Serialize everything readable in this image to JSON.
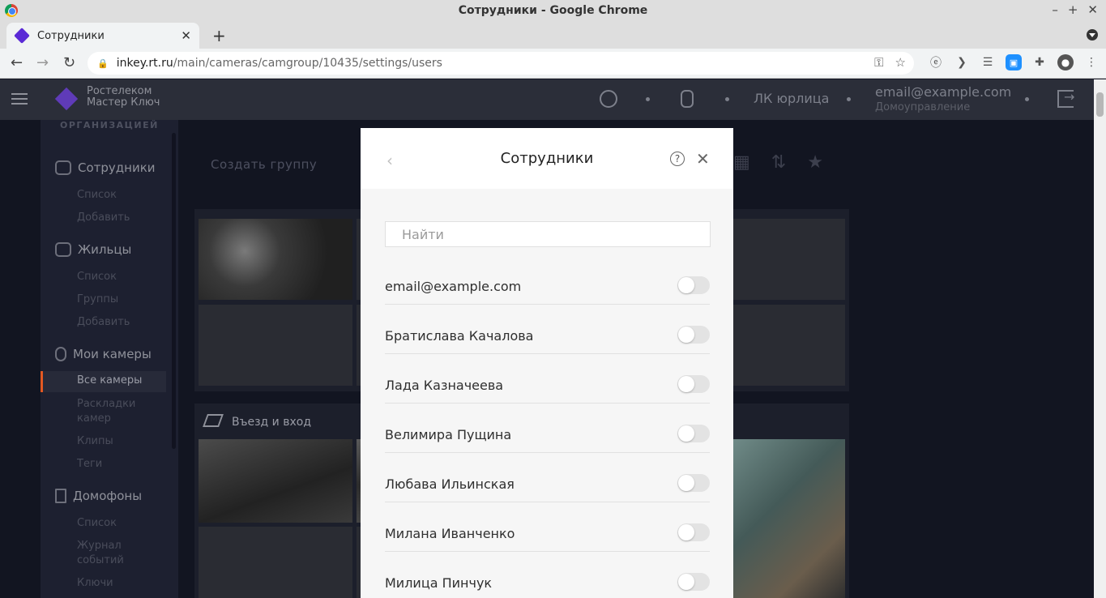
{
  "browser": {
    "window_title": "Сотрудники - Google Chrome",
    "tab_title": "Сотрудники",
    "url_host": "inkey.rt.ru",
    "url_path": "/main/cameras/camgroup/10435/settings/users"
  },
  "header": {
    "logo_line1": "Ростелеком",
    "logo_line2": "Мастер Ключ",
    "account_label": "ЛК юрлица",
    "user_email": "email@example.com",
    "user_role": "Домоуправление"
  },
  "sidebar": {
    "caption": "ОРГАНИЗАЦИЕЙ",
    "sections": [
      {
        "label": "Сотрудники",
        "items": [
          "Список",
          "Добавить"
        ]
      },
      {
        "label": "Жильцы",
        "items": [
          "Список",
          "Группы",
          "Добавить"
        ]
      },
      {
        "label": "Мои камеры",
        "items": [
          "Все камеры",
          "Раскладки камер",
          "Клипы",
          "Теги"
        ]
      },
      {
        "label": "Домофоны",
        "items": [
          "Список",
          "Журнал событий",
          "Ключи"
        ]
      }
    ],
    "active_item": "Все камеры"
  },
  "content": {
    "create_group": "Создать группу",
    "group_title": "Въезд и вход"
  },
  "modal": {
    "title": "Сотрудники",
    "help": "?",
    "search_placeholder": "Найти",
    "users": [
      "email@example.com",
      "Братислава Качалова",
      "Лада Казначеева",
      "Велимира Пущина",
      "Любава Ильинская",
      "Милана Иванченко",
      "Милица Пинчук"
    ]
  }
}
